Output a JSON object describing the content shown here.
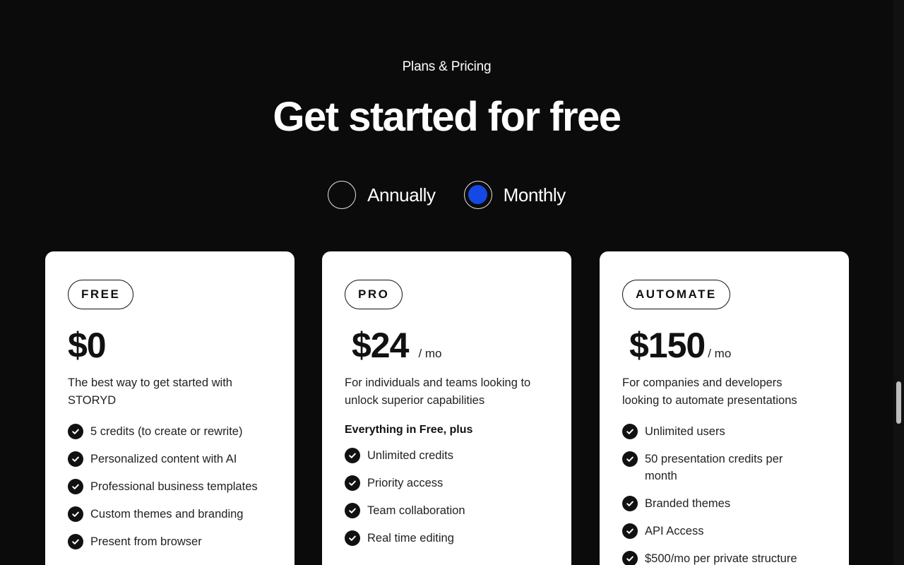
{
  "header": {
    "eyebrow": "Plans & Pricing",
    "headline": "Get started for free"
  },
  "billing_toggle": {
    "options": [
      {
        "label": "Annually",
        "selected": false
      },
      {
        "label": "Monthly",
        "selected": true
      }
    ],
    "accent_color": "#1449e6"
  },
  "plans": [
    {
      "badge": "FREE",
      "price": "$0",
      "period": "",
      "description": "The best way to get started with STORYD",
      "features": [
        "5 credits (to create or rewrite)",
        "Personalized content with AI",
        "Professional business templates",
        "Custom themes and branding",
        "Present from browser"
      ]
    },
    {
      "badge": "PRO",
      "price": "$24",
      "period": "/ mo",
      "description": "For individuals and teams looking to unlock superior  capabilities",
      "includes_heading": "Everything in Free, plus",
      "features": [
        "Unlimited credits",
        "Priority access",
        "Team collaboration",
        "Real time editing"
      ]
    },
    {
      "badge": "AUTOMATE",
      "price": "$150",
      "period": "/ mo",
      "description": "For companies and developers looking to automate presentations",
      "features": [
        "Unlimited users",
        "50 presentation credits per month",
        "Branded themes",
        "API Access",
        "$500/mo per private structure"
      ]
    }
  ],
  "icons": {
    "feature_bullet": "check-circle-icon"
  },
  "colors": {
    "background": "#0b0b0b",
    "card": "#ffffff"
  }
}
